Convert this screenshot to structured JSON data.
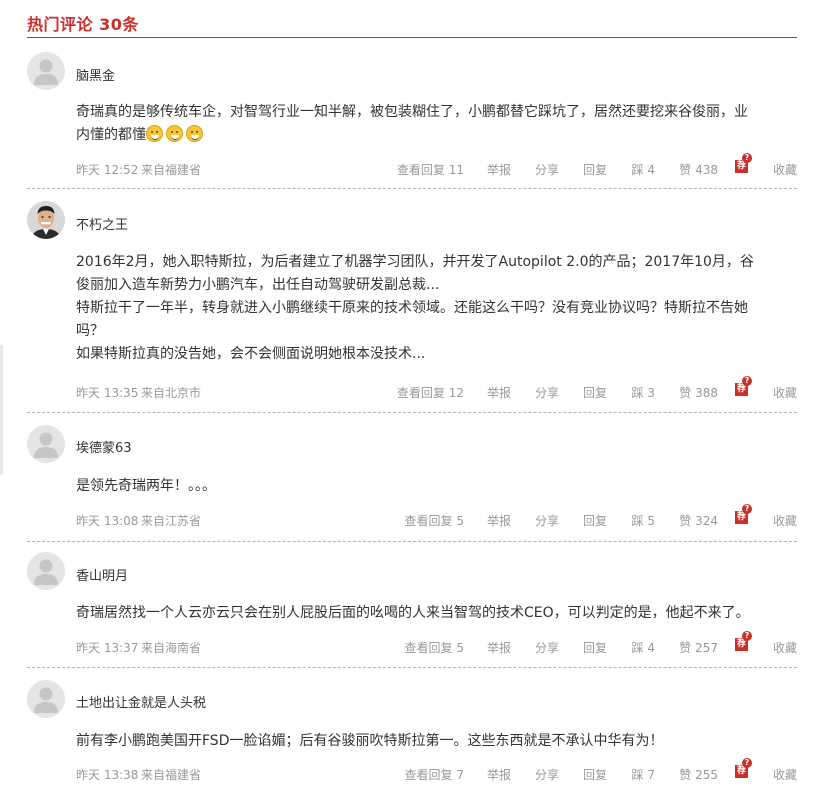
{
  "header": {
    "title": "热门评论 30条"
  },
  "comments": [
    {
      "username": "脑黑金",
      "avatar": "default-avatar",
      "lines": [
        "奇瑞真的是够传统车企，对智驾行业一知半解，被包装糊住了，小鹏都替它踩坑了，居然还要挖来谷俊丽，业",
        "内懂的都懂"
      ],
      "emoji_count": 3,
      "time": "昨天 12:52",
      "location": "来自福建省",
      "reply_count": "查看回复 11",
      "report": "举报",
      "share": "分享",
      "reply": "回复",
      "dislike": "踩 4",
      "like": "赞 438",
      "rec_badge": "荐",
      "favorite": "收藏"
    },
    {
      "username": "不朽之王",
      "avatar": "photo-avatar",
      "lines": [
        "2016年2月，她入职特斯拉，为后者建立了机器学习团队，并开发了Autopilot 2.0的产品；2017年10月，谷",
        "俊丽加入造车新势力小鹏汽车，出任自动驾驶研发副总裁...",
        "特斯拉干了一年半，转身就进入小鹏继续干原来的技术领域。还能这么干吗？没有竞业协议吗？特斯拉不告她",
        "吗？",
        "如果特斯拉真的没告她，会不会侧面说明她根本没技术..."
      ],
      "time": "昨天 13:35",
      "location": "来自北京市",
      "reply_count": "查看回复 12",
      "report": "举报",
      "share": "分享",
      "reply": "回复",
      "dislike": "踩 3",
      "like": "赞 388",
      "rec_badge": "荐",
      "favorite": "收藏"
    },
    {
      "username": "埃德蒙63",
      "avatar": "default-avatar",
      "lines": [
        "是领先奇瑞两年！。。。"
      ],
      "time": "昨天 13:08",
      "location": "来自江苏省",
      "reply_count": "查看回复 5",
      "report": "举报",
      "share": "分享",
      "reply": "回复",
      "dislike": "踩 5",
      "like": "赞 324",
      "rec_badge": "荐",
      "favorite": "收藏"
    },
    {
      "username": "香山明月",
      "avatar": "default-avatar",
      "lines": [
        "奇瑞居然找一个人云亦云只会在别人屁股后面的吆喝的人来当智驾的技术CEO，可以判定的是，他起不来了。"
      ],
      "time": "昨天 13:37",
      "location": "来自海南省",
      "reply_count": "查看回复 5",
      "report": "举报",
      "share": "分享",
      "reply": "回复",
      "dislike": "踩 4",
      "like": "赞 257",
      "rec_badge": "荐",
      "favorite": "收藏"
    },
    {
      "username": "土地出让金就是人头税",
      "avatar": "default-avatar",
      "lines": [
        "前有李小鹏跑美国开FSD一脸谄媚；后有谷骏丽吹特斯拉第一。这些东西就是不承认中华有为！"
      ],
      "time": "昨天 13:38",
      "location": "来自福建省",
      "reply_count": "查看回复 7",
      "report": "举报",
      "share": "分享",
      "reply": "回复",
      "dislike": "踩 7",
      "like": "赞 255",
      "rec_badge": "荐",
      "favorite": "收藏"
    }
  ]
}
